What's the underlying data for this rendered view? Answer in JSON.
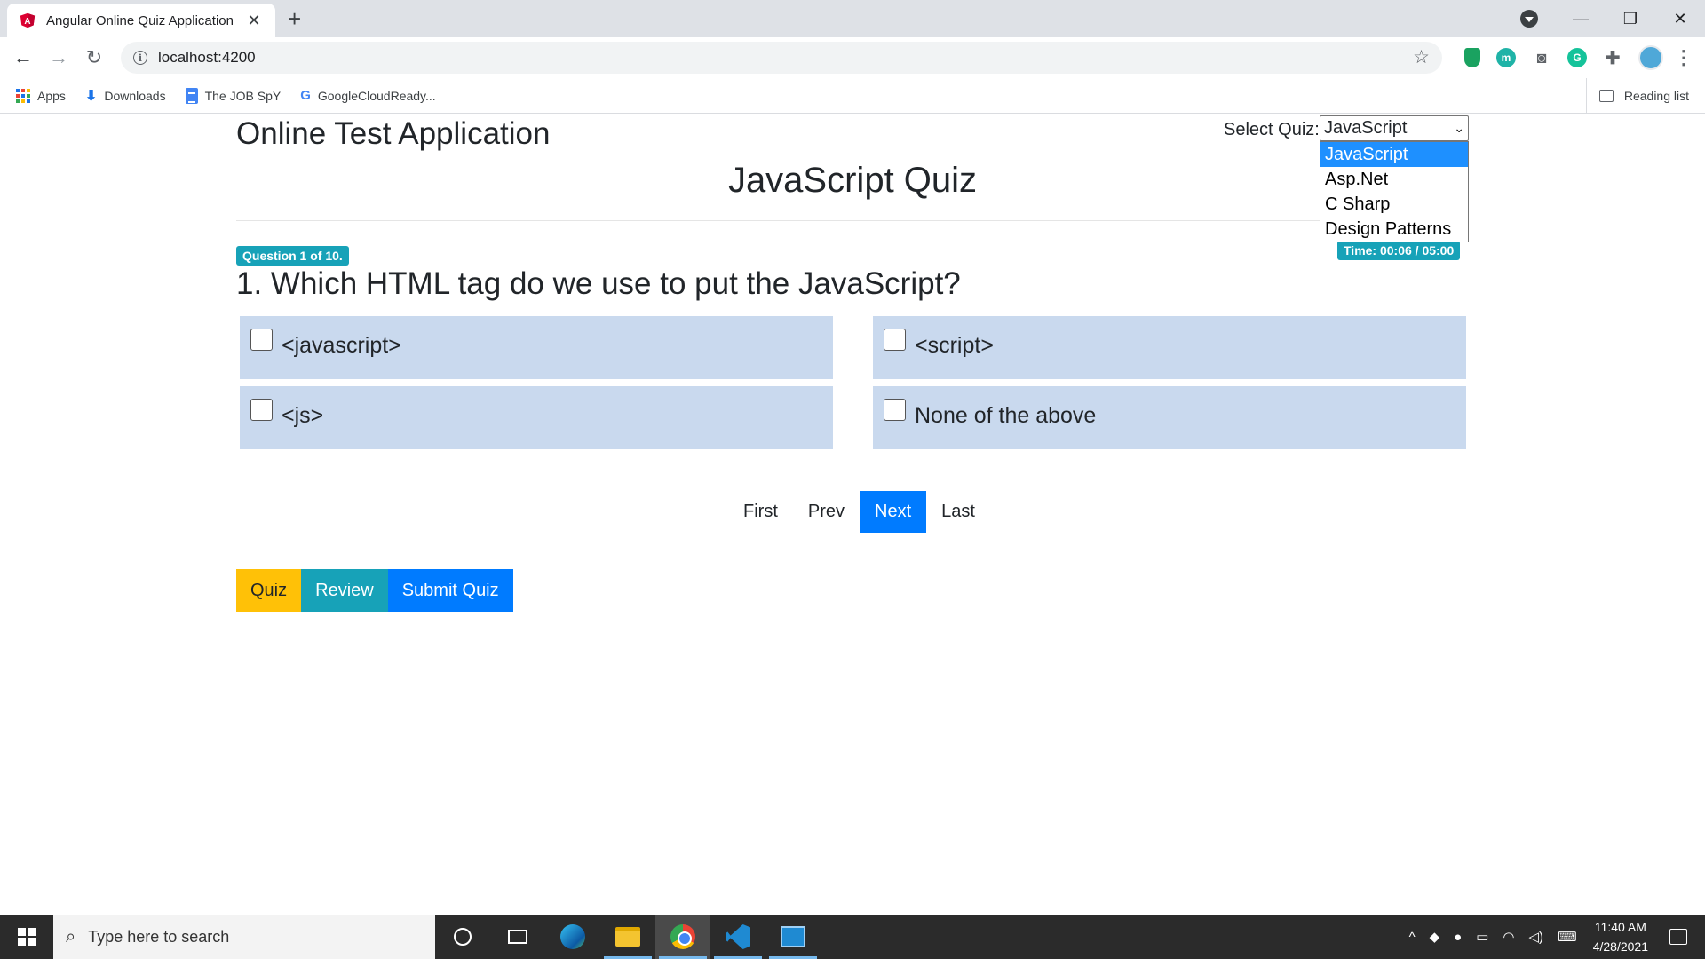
{
  "browser": {
    "tab_title": "Angular Online Quiz Application",
    "url": "localhost:4200",
    "bookmarks": [
      "Apps",
      "Downloads",
      "The JOB SpY",
      "GoogleCloudReady..."
    ],
    "reading_list": "Reading list"
  },
  "app": {
    "title": "Online Test Application",
    "select_label": "Select Quiz:",
    "selected_quiz": "JavaScript",
    "quiz_options": [
      "JavaScript",
      "Asp.Net",
      "C Sharp",
      "Design Patterns"
    ],
    "quiz_name": "JavaScript Quiz",
    "question_badge": "Question 1 of 10.",
    "time_badge": "Time: 00:06 / 05:00",
    "question": "1. Which HTML tag do we use to put the JavaScript?",
    "options": [
      "<javascript>",
      "<script>",
      "<js>",
      "None of the above"
    ],
    "pager": [
      "First",
      "Prev",
      "Next",
      "Last"
    ],
    "pager_active": "Next",
    "buttons": {
      "quiz": "Quiz",
      "review": "Review",
      "submit": "Submit Quiz"
    }
  },
  "taskbar": {
    "search_placeholder": "Type here to search",
    "time": "11:40 AM",
    "date": "4/28/2021"
  },
  "colors": {
    "primary": "#007bff",
    "info": "#17a2b8",
    "warning": "#ffc107",
    "option_bg": "#c9d9ee"
  }
}
